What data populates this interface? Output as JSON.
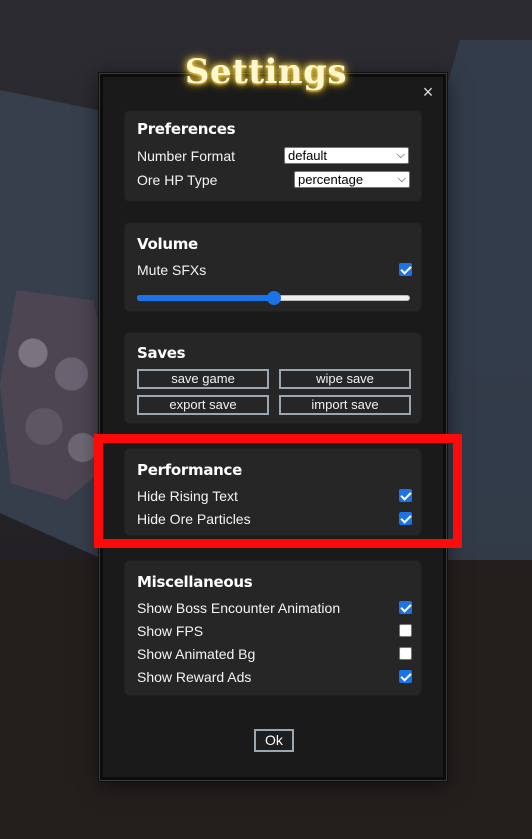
{
  "title": "Settings",
  "close_glyph": "×",
  "preferences": {
    "title": "Preferences",
    "number_format": {
      "label": "Number Format",
      "value": "default"
    },
    "ore_hp_type": {
      "label": "Ore HP Type",
      "value": "percentage"
    }
  },
  "volume": {
    "title": "Volume",
    "mute_sfx": {
      "label": "Mute SFXs",
      "checked": true
    },
    "slider_level": 0.5
  },
  "saves": {
    "title": "Saves",
    "buttons": [
      "save game",
      "wipe save",
      "export save",
      "import save"
    ]
  },
  "performance": {
    "title": "Performance",
    "hide_rising_text": {
      "label": "Hide Rising Text",
      "checked": true
    },
    "hide_ore_particles": {
      "label": "Hide Ore Particles",
      "checked": true
    }
  },
  "misc": {
    "title": "Miscellaneous",
    "items": [
      {
        "label": "Show Boss Encounter Animation",
        "checked": true
      },
      {
        "label": "Show FPS",
        "checked": false
      },
      {
        "label": "Show Animated Bg",
        "checked": false
      },
      {
        "label": "Show Reward Ads",
        "checked": true
      }
    ]
  },
  "ok_label": "Ok",
  "highlight_color": "#ff0a0a",
  "accent_color": "#1a73e8"
}
